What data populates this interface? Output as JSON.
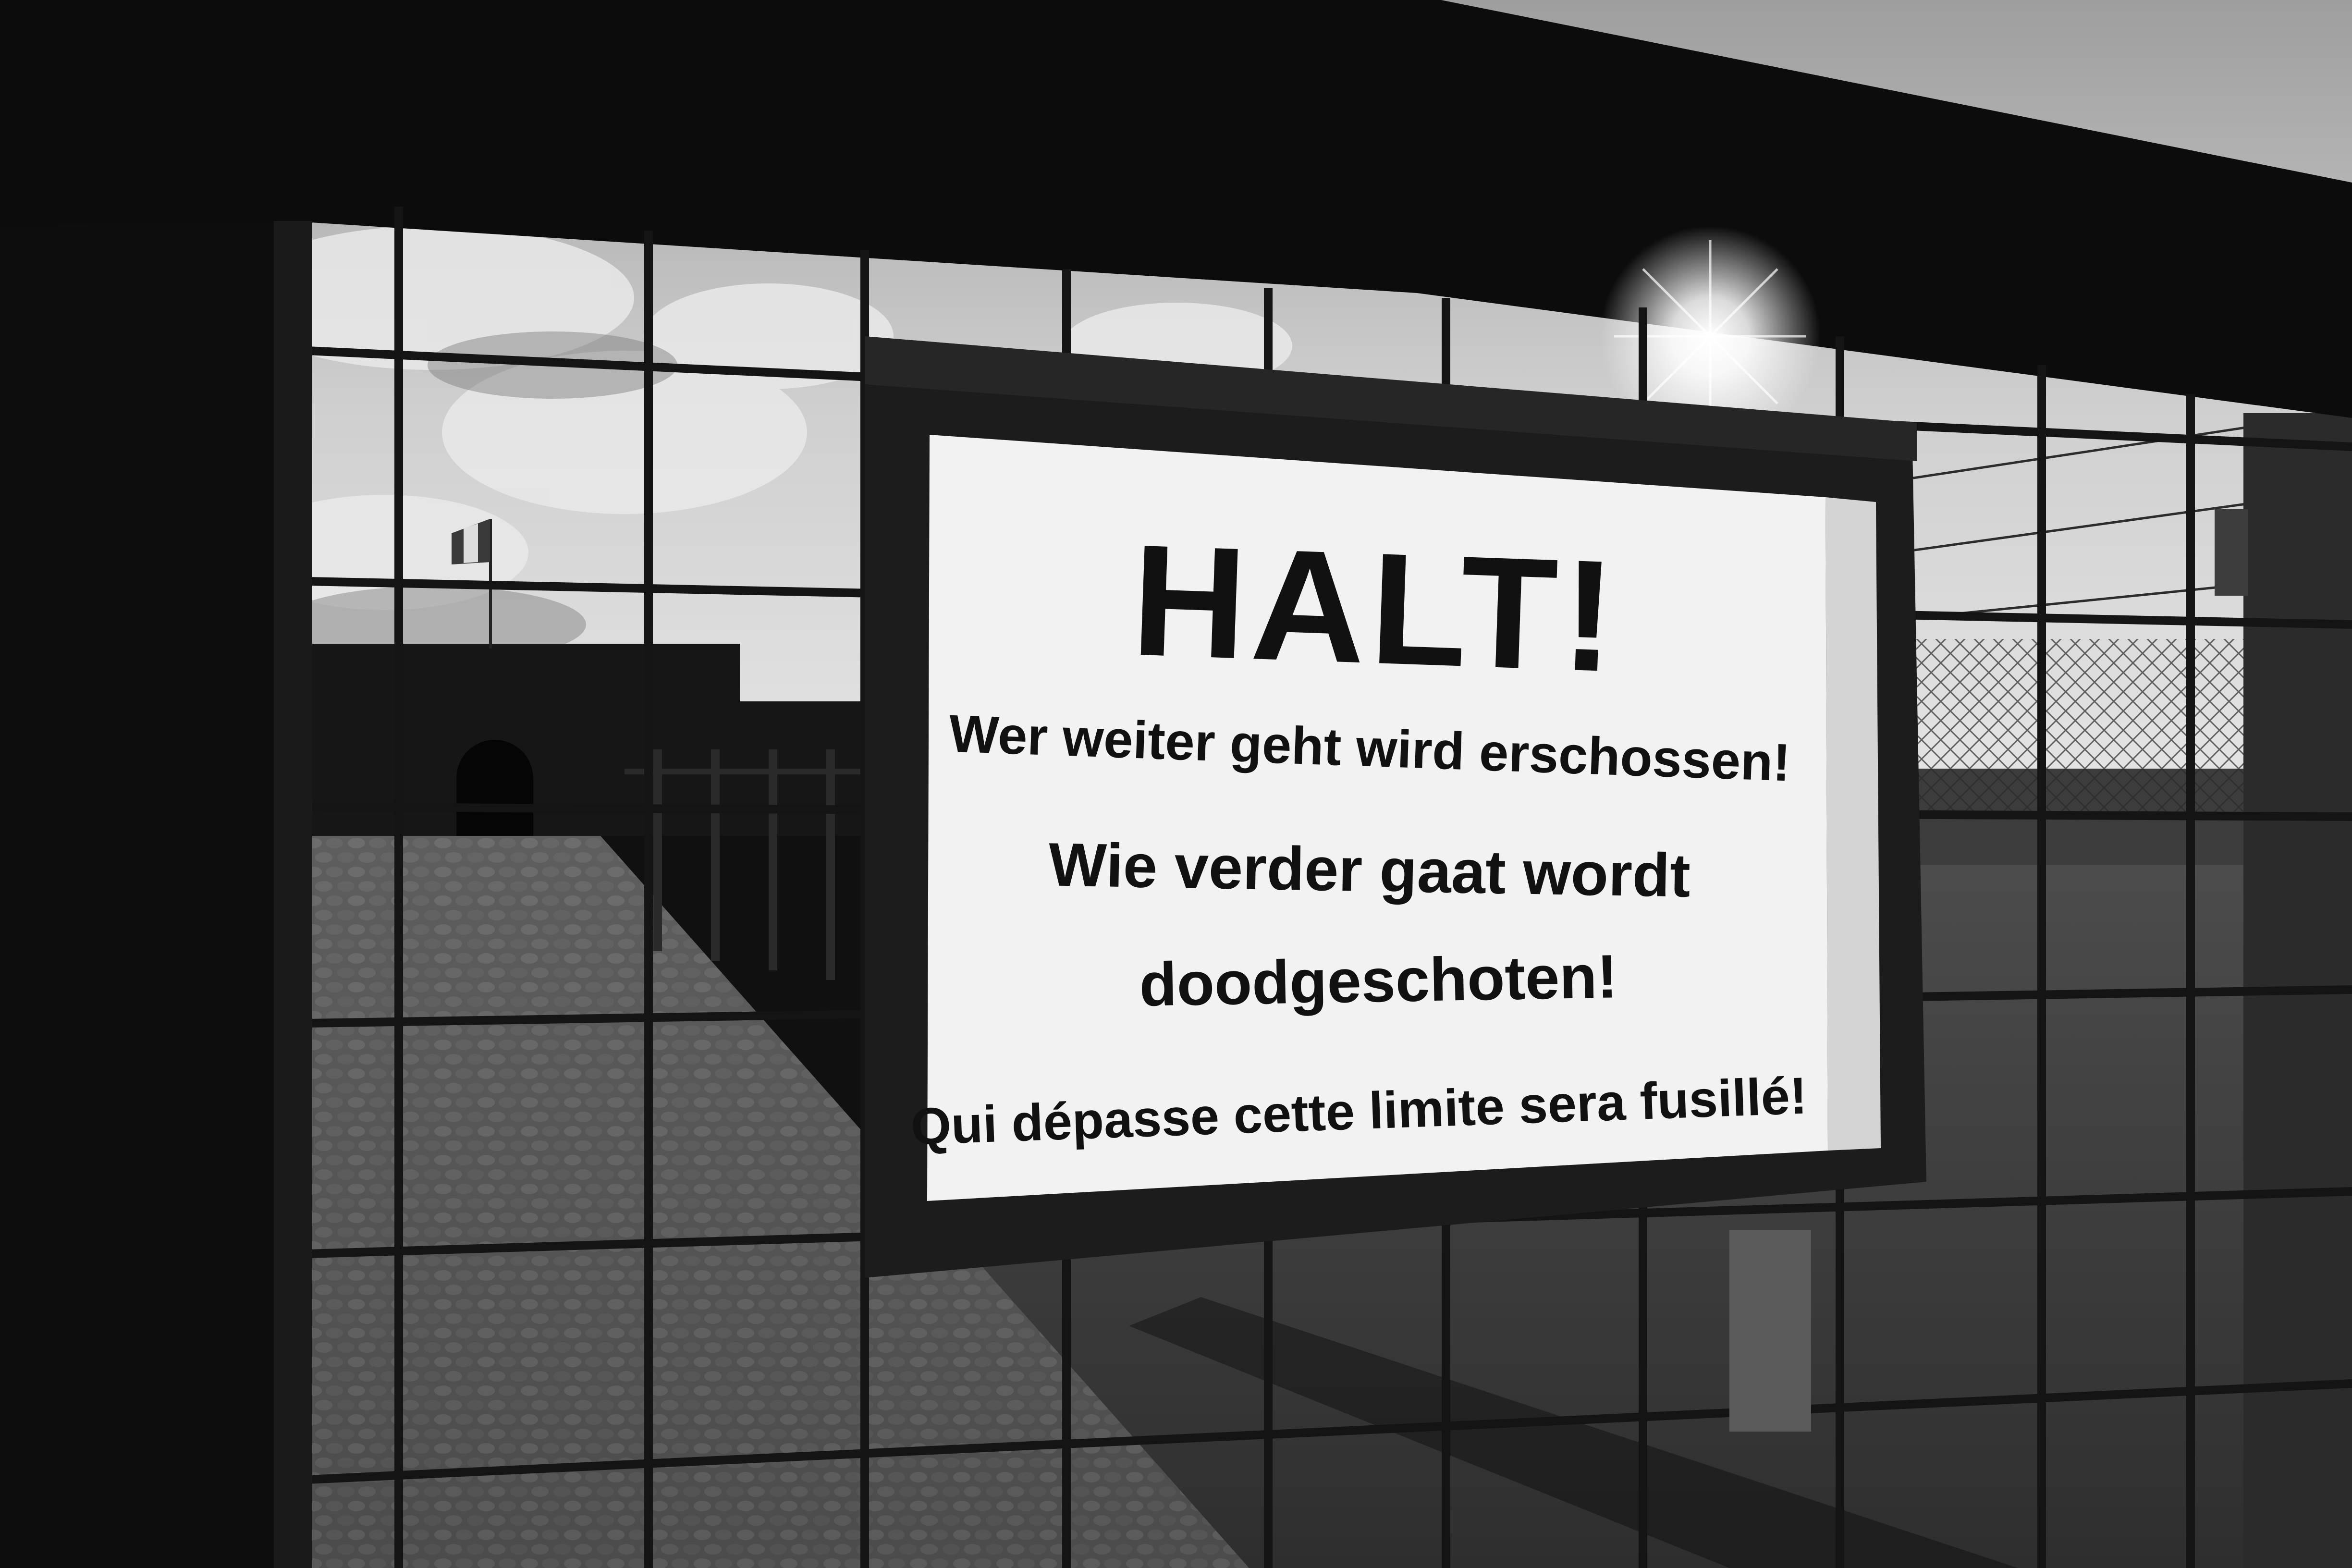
{
  "sign": {
    "headline": "HALT!",
    "line_german": "Wer  weiter geht  wird erschossen!",
    "line_dutch_1": "Wie verder gaat  wordt",
    "line_dutch_2": "doodgeschoten!",
    "line_french": "Qui dépasse cette limite sera fusillé!"
  },
  "colors": {
    "sign_face": "#f2f2f2",
    "sign_frame": "#1c1c1c",
    "fence_wire": "#141414",
    "sky": "#b9b9b9",
    "ground": "#5a5a5a"
  }
}
